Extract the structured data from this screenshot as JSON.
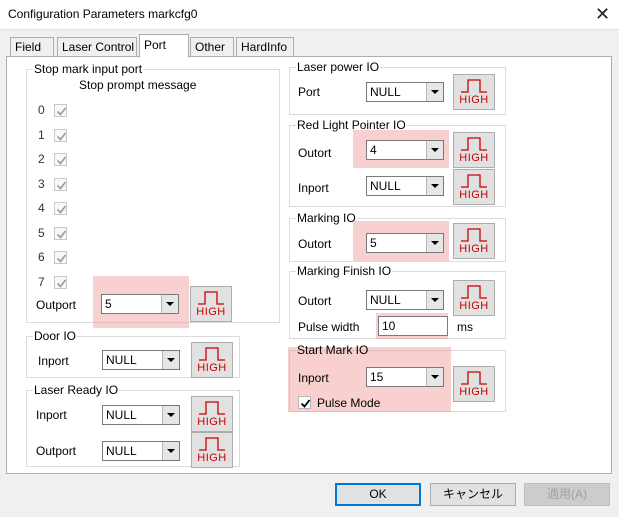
{
  "window": {
    "title": "Configuration Parameters markcfg0"
  },
  "tabs": [
    {
      "label": "Field"
    },
    {
      "label": "Laser Control"
    },
    {
      "label": "Port"
    },
    {
      "label": "Other"
    },
    {
      "label": "HardInfo"
    }
  ],
  "stop_mark": {
    "legend": "Stop mark input port",
    "prompt_header": "Stop prompt message",
    "ports": [
      "0",
      "1",
      "2",
      "3",
      "4",
      "5",
      "6",
      "7"
    ],
    "outport_label": "Outport",
    "outport_value": "5"
  },
  "door_io": {
    "legend": "Door IO",
    "input_label": "Inport",
    "input_value": "NULL"
  },
  "laser_ready_io": {
    "legend": "Laser Ready IO",
    "input_label": "Inport",
    "input_value": "NULL",
    "output_label": "Outport",
    "output_value": "NULL"
  },
  "laser_power_io": {
    "legend": "Laser power IO",
    "port_label": "Port",
    "port_value": "NULL"
  },
  "red_light_io": {
    "legend": "Red Light Pointer IO",
    "outport_label": "Outort",
    "outport_value": "4",
    "inport_label": "Inport",
    "inport_value": "NULL"
  },
  "marking_io": {
    "legend": "Marking IO",
    "outport_label": "Outort",
    "outport_value": "5"
  },
  "marking_finish_io": {
    "legend": "Marking Finish IO",
    "outport_label": "Outort",
    "outport_value": "NULL",
    "pulse_label": "Pulse width",
    "pulse_value": "10",
    "pulse_unit": "ms"
  },
  "start_mark_io": {
    "legend": "Start Mark IO",
    "inport_label": "Inport",
    "inport_value": "15",
    "pulse_mode_label": "Pulse Mode"
  },
  "high_label": "HIGH",
  "buttons": {
    "ok": "OK",
    "cancel": "キャンセル",
    "apply": "適用(A)"
  },
  "colors": {
    "highlight": "#f09696",
    "high_text": "#cc0000",
    "accent": "#0078d7"
  }
}
